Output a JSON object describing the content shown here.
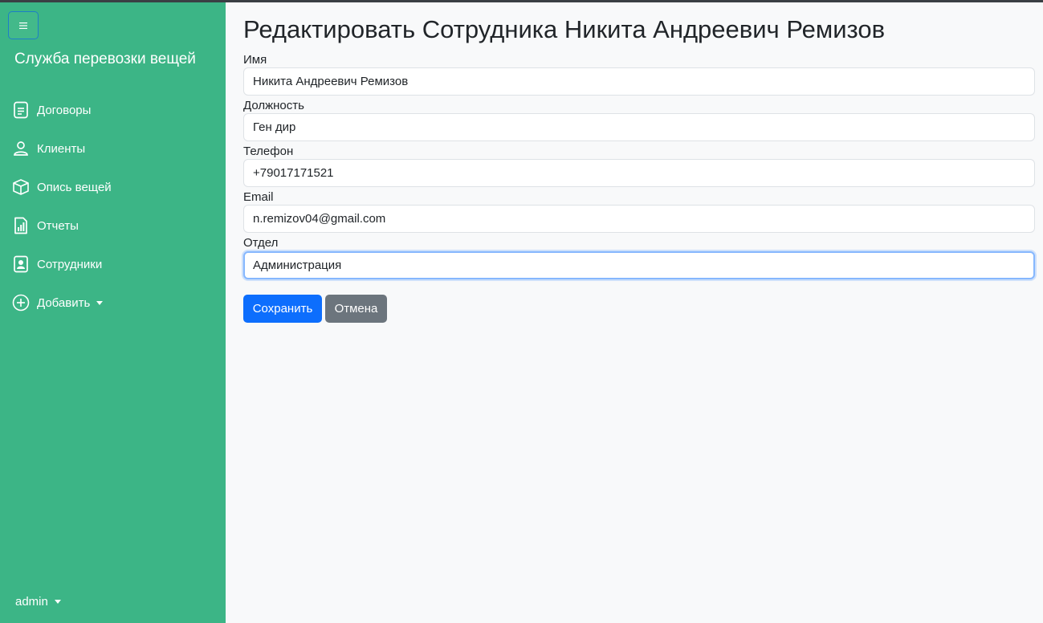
{
  "sidebar": {
    "brand": "Служба перевозки вещей",
    "items": [
      {
        "label": "Договоры",
        "icon": "file-text-icon"
      },
      {
        "label": "Клиенты",
        "icon": "person-icon"
      },
      {
        "label": "Опись вещей",
        "icon": "box-icon"
      },
      {
        "label": "Отчеты",
        "icon": "report-icon"
      },
      {
        "label": "Сотрудники",
        "icon": "person-badge-icon"
      },
      {
        "label": "Добавить",
        "icon": "plus-circle-icon"
      }
    ],
    "user": "admin"
  },
  "form": {
    "title": "Редактировать Сотрудника Никита Андреевич Ремизов",
    "fields": [
      {
        "label": "Имя",
        "value": "Никита Андреевич Ремизов"
      },
      {
        "label": "Должность",
        "value": "Ген дир"
      },
      {
        "label": "Телефон",
        "value": "+79017171521"
      },
      {
        "label": "Email",
        "value": "n.remizov04@gmail.com"
      },
      {
        "label": "Отдел",
        "value": "Администрация"
      }
    ],
    "save_label": "Сохранить",
    "cancel_label": "Отмена"
  },
  "colors": {
    "sidebar_bg": "#3cb586",
    "primary": "#0d6efd",
    "secondary": "#6c757d",
    "page_bg": "#f8f9fa"
  }
}
